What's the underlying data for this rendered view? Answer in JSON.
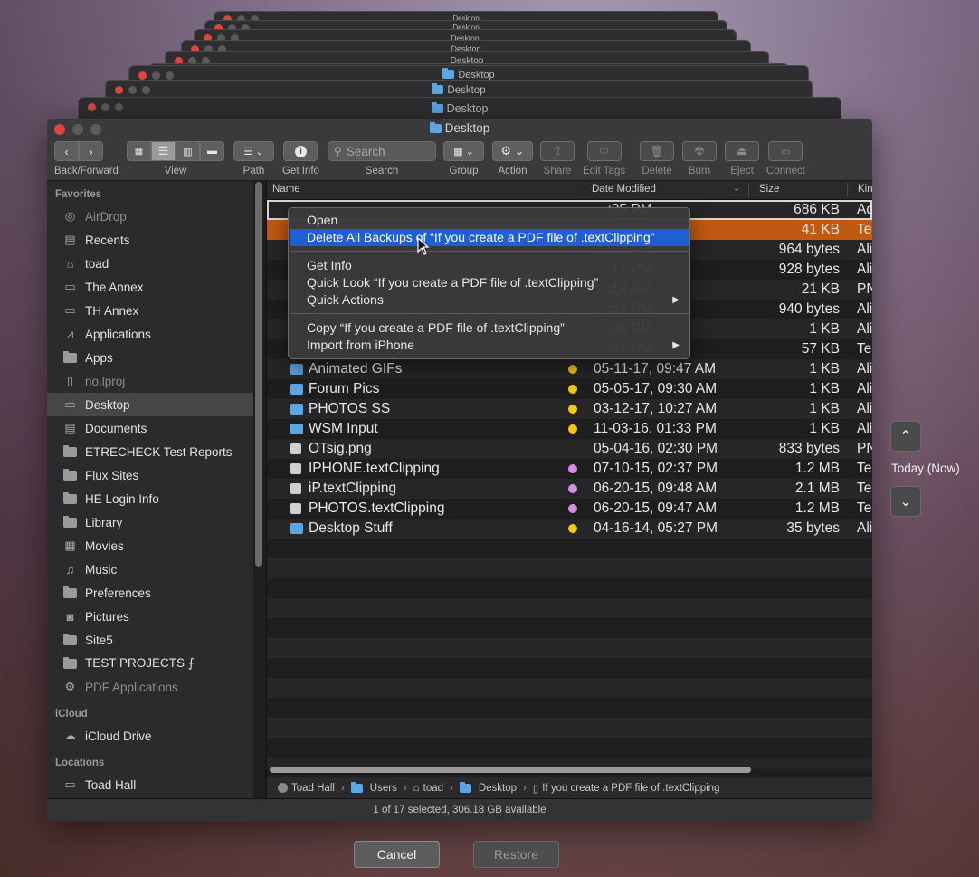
{
  "stack_title": "Desktop",
  "window": {
    "title": "Desktop"
  },
  "toolbar": {
    "back_forward": "Back/Forward",
    "view": "View",
    "path": "Path",
    "get_info": "Get Info",
    "search_placeholder": "Search",
    "search": "Search",
    "group": "Group",
    "action": "Action",
    "share": "Share",
    "edit_tags": "Edit Tags",
    "delete": "Delete",
    "burn": "Burn",
    "eject": "Eject",
    "connect": "Connect"
  },
  "sidebar": {
    "favorites_header": "Favorites",
    "favorites": [
      {
        "label": "AirDrop",
        "icon": "airdrop-icon"
      },
      {
        "label": "Recents",
        "icon": "recents-icon"
      },
      {
        "label": "toad",
        "icon": "home-icon"
      },
      {
        "label": "The Annex",
        "icon": "drive-icon"
      },
      {
        "label": "TH Annex",
        "icon": "drive-icon"
      },
      {
        "label": "Applications",
        "icon": "applications-icon"
      },
      {
        "label": "Apps",
        "icon": "folder-icon"
      },
      {
        "label": "no.lproj",
        "icon": "document-icon"
      },
      {
        "label": "Desktop",
        "icon": "desktop-icon"
      },
      {
        "label": "Documents",
        "icon": "documents-icon"
      },
      {
        "label": "ETRECHECK Test Reports",
        "icon": "folder-icon"
      },
      {
        "label": "Flux Sites",
        "icon": "folder-icon"
      },
      {
        "label": "HE Login Info",
        "icon": "folder-icon"
      },
      {
        "label": "Library",
        "icon": "folder-icon"
      },
      {
        "label": "Movies",
        "icon": "movies-icon"
      },
      {
        "label": "Music",
        "icon": "music-icon"
      },
      {
        "label": "Preferences",
        "icon": "folder-icon"
      },
      {
        "label": "Pictures",
        "icon": "pictures-icon"
      },
      {
        "label": "Site5",
        "icon": "folder-icon"
      },
      {
        "label": "TEST PROJECTS ⨍",
        "icon": "folder-icon"
      },
      {
        "label": "PDF Applications",
        "icon": "gear-icon"
      }
    ],
    "icloud_header": "iCloud",
    "icloud_drive": "iCloud Drive",
    "locations_header": "Locations",
    "toad_hall": "Toad Hall"
  },
  "columns": {
    "name": "Name",
    "date": "Date Modified",
    "size": "Size",
    "kind": "Kin"
  },
  "rows": [
    {
      "name": "",
      "date": "…:35 PM",
      "size": "686 KB",
      "kind": "Ad",
      "tag": ""
    },
    {
      "name": "",
      "date": "…:23 AM",
      "size": "41 KB",
      "kind": "Te",
      "tag": ""
    },
    {
      "name": "",
      "date": "…:02 AM",
      "size": "964 bytes",
      "kind": "Ali",
      "tag": ""
    },
    {
      "name": "",
      "date": "…:17 PM",
      "size": "928 bytes",
      "kind": "Ali",
      "tag": ""
    },
    {
      "name": "",
      "date": "…:14 AM",
      "size": "21 KB",
      "kind": "PN",
      "tag": ""
    },
    {
      "name": "",
      "date": "…:54 PM",
      "size": "940 bytes",
      "kind": "Ali",
      "tag": ""
    },
    {
      "name": "",
      "date": "…:46 PM",
      "size": "1 KB",
      "kind": "Ali",
      "tag": ""
    },
    {
      "name": "",
      "date": "…:07 PM",
      "size": "57 KB",
      "kind": "Te",
      "tag": ""
    },
    {
      "name": "Animated GIFs",
      "date": "05-11-17, 09:47 AM",
      "size": "1 KB",
      "kind": "Ali",
      "tag": "#f5c518"
    },
    {
      "name": "Forum Pics",
      "date": "05-05-17, 09:30 AM",
      "size": "1 KB",
      "kind": "Ali",
      "tag": "#f5c518"
    },
    {
      "name": "PHOTOS SS",
      "date": "03-12-17, 10:27 AM",
      "size": "1 KB",
      "kind": "Ali",
      "tag": "#f5c518"
    },
    {
      "name": "WSM Input",
      "date": "11-03-16, 01:33 PM",
      "size": "1 KB",
      "kind": "Ali",
      "tag": "#f5c518"
    },
    {
      "name": "OTsig.png",
      "date": "05-04-16, 02:30 PM",
      "size": "833 bytes",
      "kind": "PN",
      "tag": ""
    },
    {
      "name": "IPHONE.textClipping",
      "date": "07-10-15, 02:37 PM",
      "size": "1.2 MB",
      "kind": "Te",
      "tag": "#d98ce6"
    },
    {
      "name": "iP.textClipping",
      "date": "06-20-15, 09:48 AM",
      "size": "2.1 MB",
      "kind": "Te",
      "tag": "#d98ce6"
    },
    {
      "name": "PHOTOS.textClipping",
      "date": "06-20-15, 09:47 AM",
      "size": "1.2 MB",
      "kind": "Te",
      "tag": "#d98ce6"
    },
    {
      "name": "Desktop Stuff",
      "date": "04-16-14, 05:27 PM",
      "size": "35 bytes",
      "kind": "Ali",
      "tag": "#f5c518"
    }
  ],
  "context_menu": {
    "open": "Open",
    "delete_backups": "Delete All Backups of “If you create a PDF file of .textClipping”",
    "get_info": "Get Info",
    "quick_look": "Quick Look “If you create a PDF file of .textClipping”",
    "quick_actions": "Quick Actions",
    "copy": "Copy “If you create a PDF file of .textClipping”",
    "import": "Import from iPhone"
  },
  "pathbar": {
    "toad_hall": "Toad Hall",
    "users": "Users",
    "toad": "toad",
    "desktop": "Desktop",
    "file": "If you create a PDF file of .textClipping"
  },
  "status": "1 of 17 selected, 306.18 GB available",
  "timemachine": {
    "today": "Today (Now)",
    "cancel": "Cancel",
    "restore": "Restore"
  },
  "colors": {
    "selection_orange": "#c05a12",
    "menu_highlight": "#1f5fd4",
    "folder_blue": "#5aa7e6"
  }
}
